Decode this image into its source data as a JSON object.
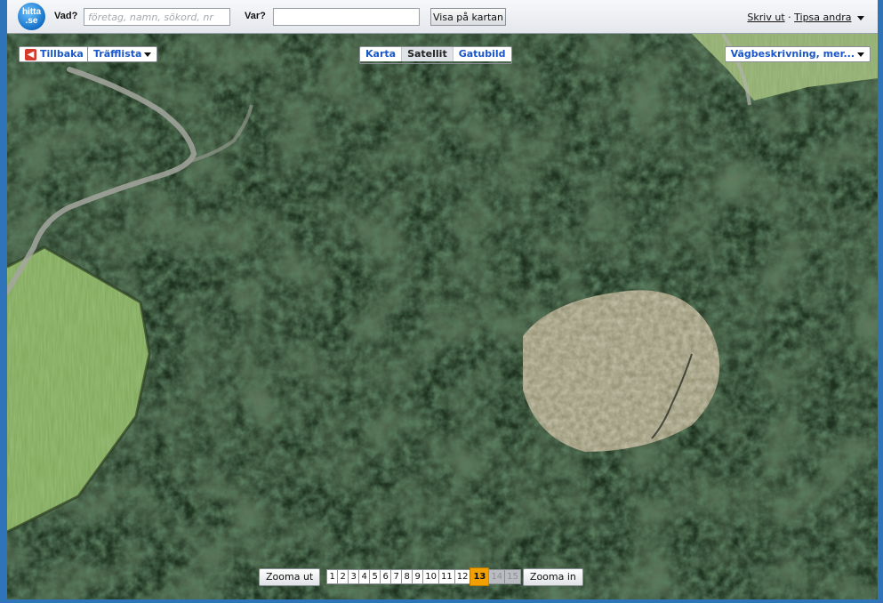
{
  "header": {
    "logo_text": "hitta.se",
    "what_label": "Vad?",
    "what_placeholder": "företag, namn, sökord, nr",
    "what_value": "",
    "where_label": "Var?",
    "where_value": "",
    "show_on_map_label": "Visa på kartan",
    "print_label": "Skriv ut",
    "separator": "·",
    "suggest_change_label": "Tipsa andra"
  },
  "map_controls": {
    "back_label": "Tillbaka",
    "hitlist_label": "Träfflista",
    "map_types": [
      {
        "label": "Karta",
        "active": false
      },
      {
        "label": "Satellit",
        "active": true
      },
      {
        "label": "Gatubild",
        "active": false
      }
    ],
    "directions_label": "Vägbeskrivning, mer..."
  },
  "zoom": {
    "zoom_out_label": "Zooma ut",
    "zoom_in_label": "Zooma in",
    "levels": [
      "1",
      "2",
      "3",
      "4",
      "5",
      "6",
      "7",
      "8",
      "9",
      "10",
      "11",
      "12",
      "13",
      "14",
      "15"
    ],
    "current_level": "13",
    "disabled_levels": [
      "14",
      "15"
    ]
  },
  "colors": {
    "accent_link": "#1a57c8",
    "current_zoom": "#f2a000",
    "frame": "#2f74b8",
    "back_icon": "#d63a2a"
  },
  "icons": {
    "back": "left-arrow-icon",
    "dropdown": "caret-down-icon"
  }
}
